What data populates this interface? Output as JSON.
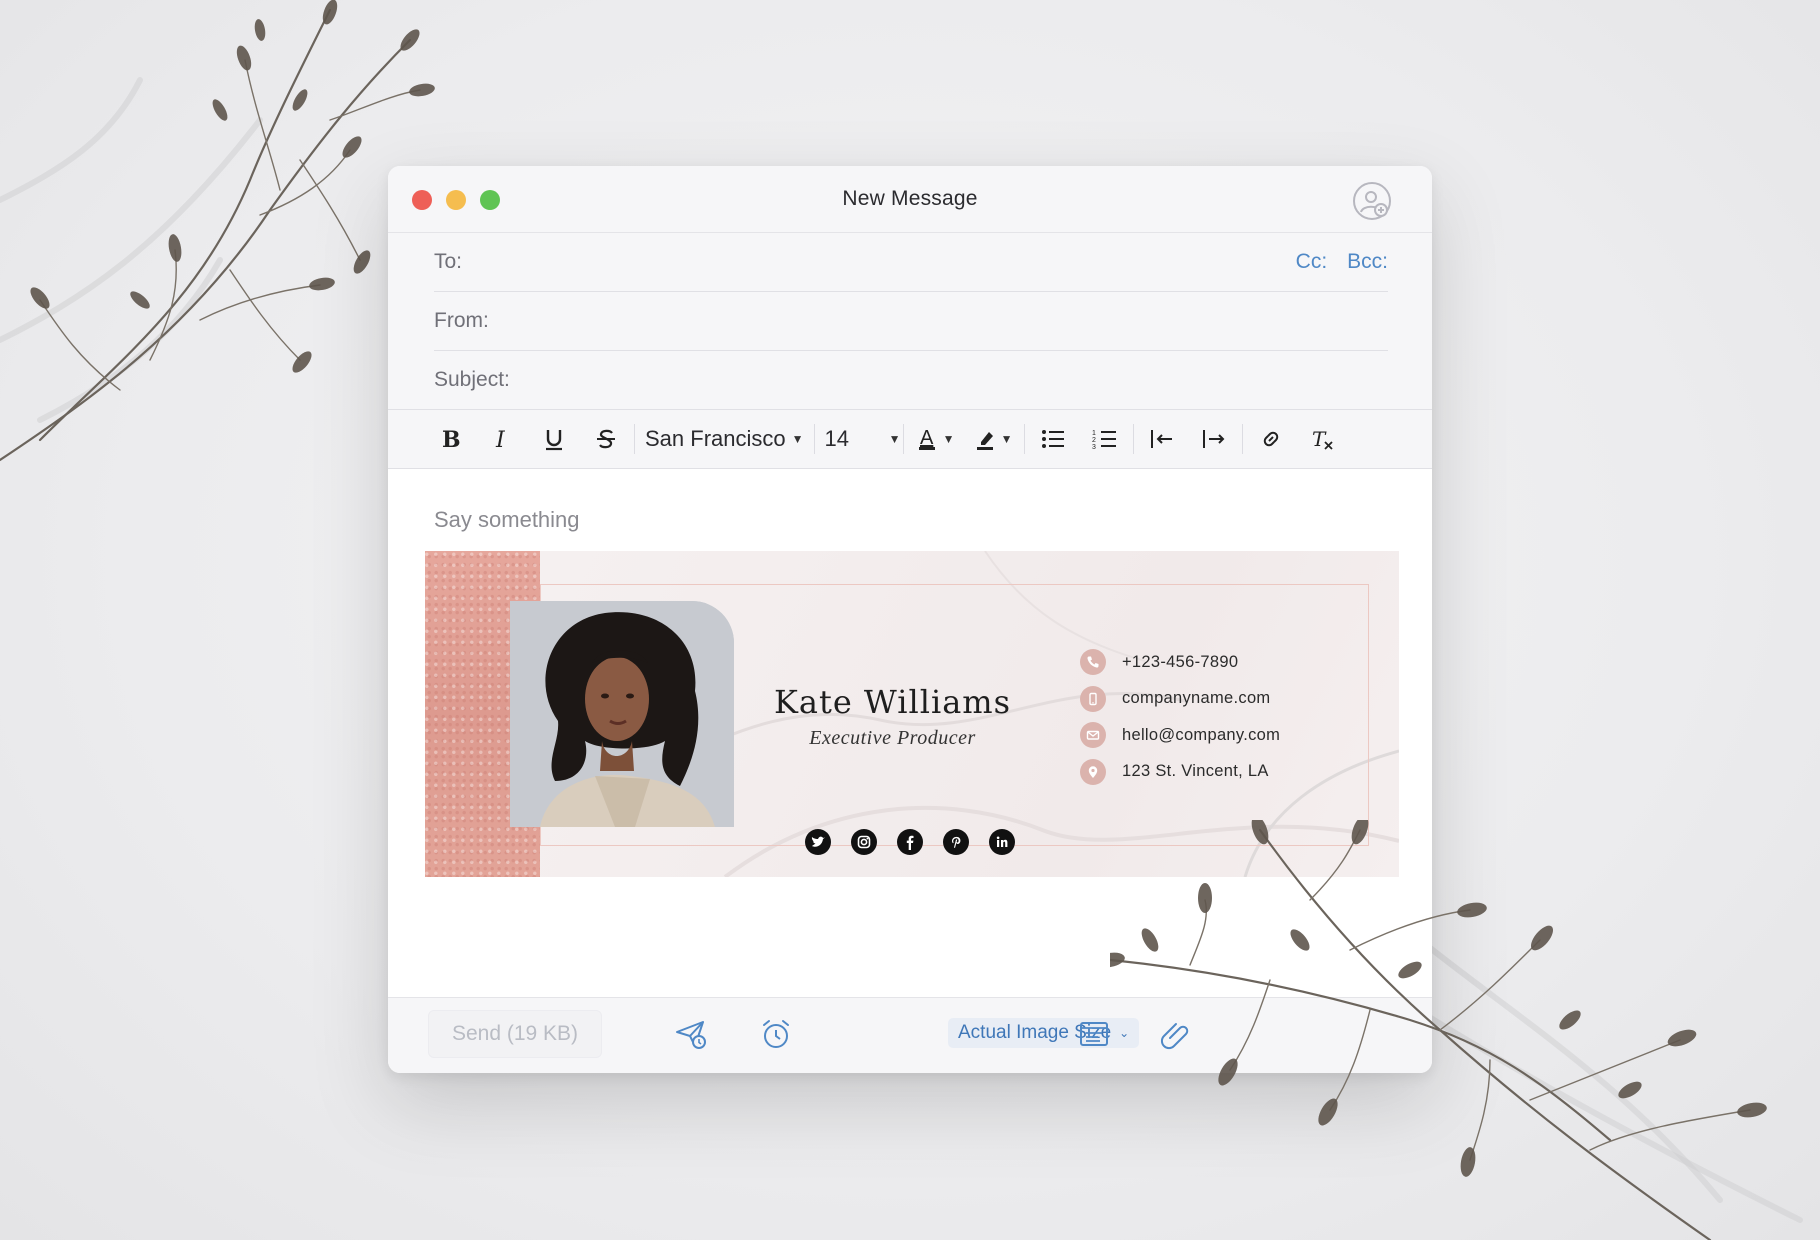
{
  "window": {
    "title": "New Message"
  },
  "header": {
    "to_label": "To:",
    "from_label": "From:",
    "subject_label": "Subject:",
    "cc_label": "Cc:",
    "bcc_label": "Bcc:"
  },
  "toolbar": {
    "font_name": "San Francisco",
    "font_size": "14",
    "clear_format_label": "Tx"
  },
  "body": {
    "placeholder": "Say something"
  },
  "signature": {
    "name": "Kate Williams",
    "role": "Executive Producer",
    "phone": "+123-456-7890",
    "website": "companyname.com",
    "email": "hello@company.com",
    "address": "123 St. Vincent, LA",
    "socials": [
      "twitter-icon",
      "instagram-icon",
      "facebook-icon",
      "pinterest-icon",
      "linkedin-icon"
    ]
  },
  "footer": {
    "send_label": "Send (19 KB)",
    "image_size_label": "Actual Image Size"
  },
  "colors": {
    "accent_blue": "#4f88c6",
    "glitter_pink": "#dd9a8f",
    "contact_icon_bg": "#dbb3ad",
    "close": "#ee5f57",
    "minimize": "#f5bd4f",
    "maximize": "#5fc454"
  }
}
